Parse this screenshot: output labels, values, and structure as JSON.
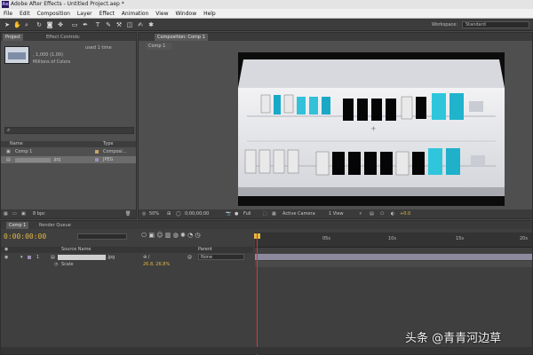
{
  "window": {
    "title": "Adobe After Effects - Untitled Project.aep *",
    "app_icon": "Ae"
  },
  "menu": [
    "File",
    "Edit",
    "Composition",
    "Layer",
    "Effect",
    "Animation",
    "View",
    "Window",
    "Help"
  ],
  "toolbar": {
    "tools": [
      "selection-tool-icon",
      "hand-tool-icon",
      "zoom-tool-icon",
      "rotate-tool-icon",
      "camera-tool-icon",
      "pan-behind-tool-icon",
      "rectangle-tool-icon",
      "pen-tool-icon",
      "text-tool-icon",
      "brush-tool-icon",
      "clone-stamp-tool-icon",
      "eraser-tool-icon",
      "roto-brush-tool-icon",
      "puppet-tool-icon"
    ],
    "workspace_label": "Workspace:",
    "workspace_value": "Standard"
  },
  "project_panel": {
    "tabs": [
      "Project",
      "Effect Controls:"
    ],
    "info_lines": [
      "used 1 time",
      ", 1,000 (1.00)",
      "Millions of Colors"
    ],
    "columns": [
      "Name",
      "Type"
    ],
    "items": [
      {
        "name": "Comp 1",
        "type": "Composi..."
      },
      {
        "name": ".jpg",
        "type": "JPEG"
      }
    ],
    "bpc": "8 bpc"
  },
  "composition_panel": {
    "tab": "Composition: Comp 1",
    "subtab": "Comp 1",
    "zoom": "50%",
    "timecode": "0;00;00;00",
    "resolution": "Full",
    "camera": "Active Camera",
    "view_layout": "1 View",
    "exposure": "+0.0"
  },
  "timeline": {
    "tabs": [
      "Comp 1",
      "Render Queue"
    ],
    "timecode": "0:00:00:00",
    "columns": [
      "Source Name",
      "Parent"
    ],
    "layers": [
      {
        "index": "1",
        "name": ".jpg",
        "parent": "None"
      }
    ],
    "property": {
      "name": "Scale",
      "value": "26.8, 26.8%"
    },
    "ruler_marks": [
      "05s",
      "10s",
      "15s",
      "20s"
    ]
  },
  "colors": {
    "timecode": "#e2b840",
    "cti": "#dd3333",
    "layer_bar": "#8e8a9e",
    "label_tan": "#c9a46a"
  },
  "watermark": "头条 @青青河边草"
}
